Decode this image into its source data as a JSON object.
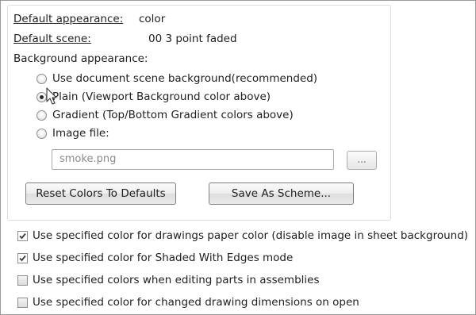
{
  "appearance": {
    "default_appearance_label": "Default appearance:",
    "default_appearance_value": "color",
    "default_scene_label": "Default scene:",
    "default_scene_value": "00 3 point faded",
    "background_appearance_label": "Background appearance:",
    "options": [
      {
        "label": "Use document scene background(recommended)",
        "selected": false
      },
      {
        "label": "Plain (Viewport Background color above)",
        "selected": true
      },
      {
        "label": "Gradient (Top/Bottom Gradient colors above)",
        "selected": false
      },
      {
        "label": "Image file:",
        "selected": false
      }
    ],
    "image_file_placeholder": "smoke.png",
    "browse_label": "...",
    "reset_button_label": "Reset Colors To Defaults",
    "save_scheme_button_label": "Save As Scheme..."
  },
  "checkboxes": [
    {
      "label": "Use specified color for drawings paper color (disable image in sheet background)",
      "checked": true
    },
    {
      "label": "Use specified color for Shaded With Edges mode",
      "checked": true
    },
    {
      "label": "Use specified colors when editing parts in assemblies",
      "checked": false
    },
    {
      "label": "Use specified color for changed drawing dimensions on open",
      "checked": false
    }
  ],
  "colors": {
    "panel_border": "#dcdcdc",
    "check_mark": "#3a3a3a"
  }
}
